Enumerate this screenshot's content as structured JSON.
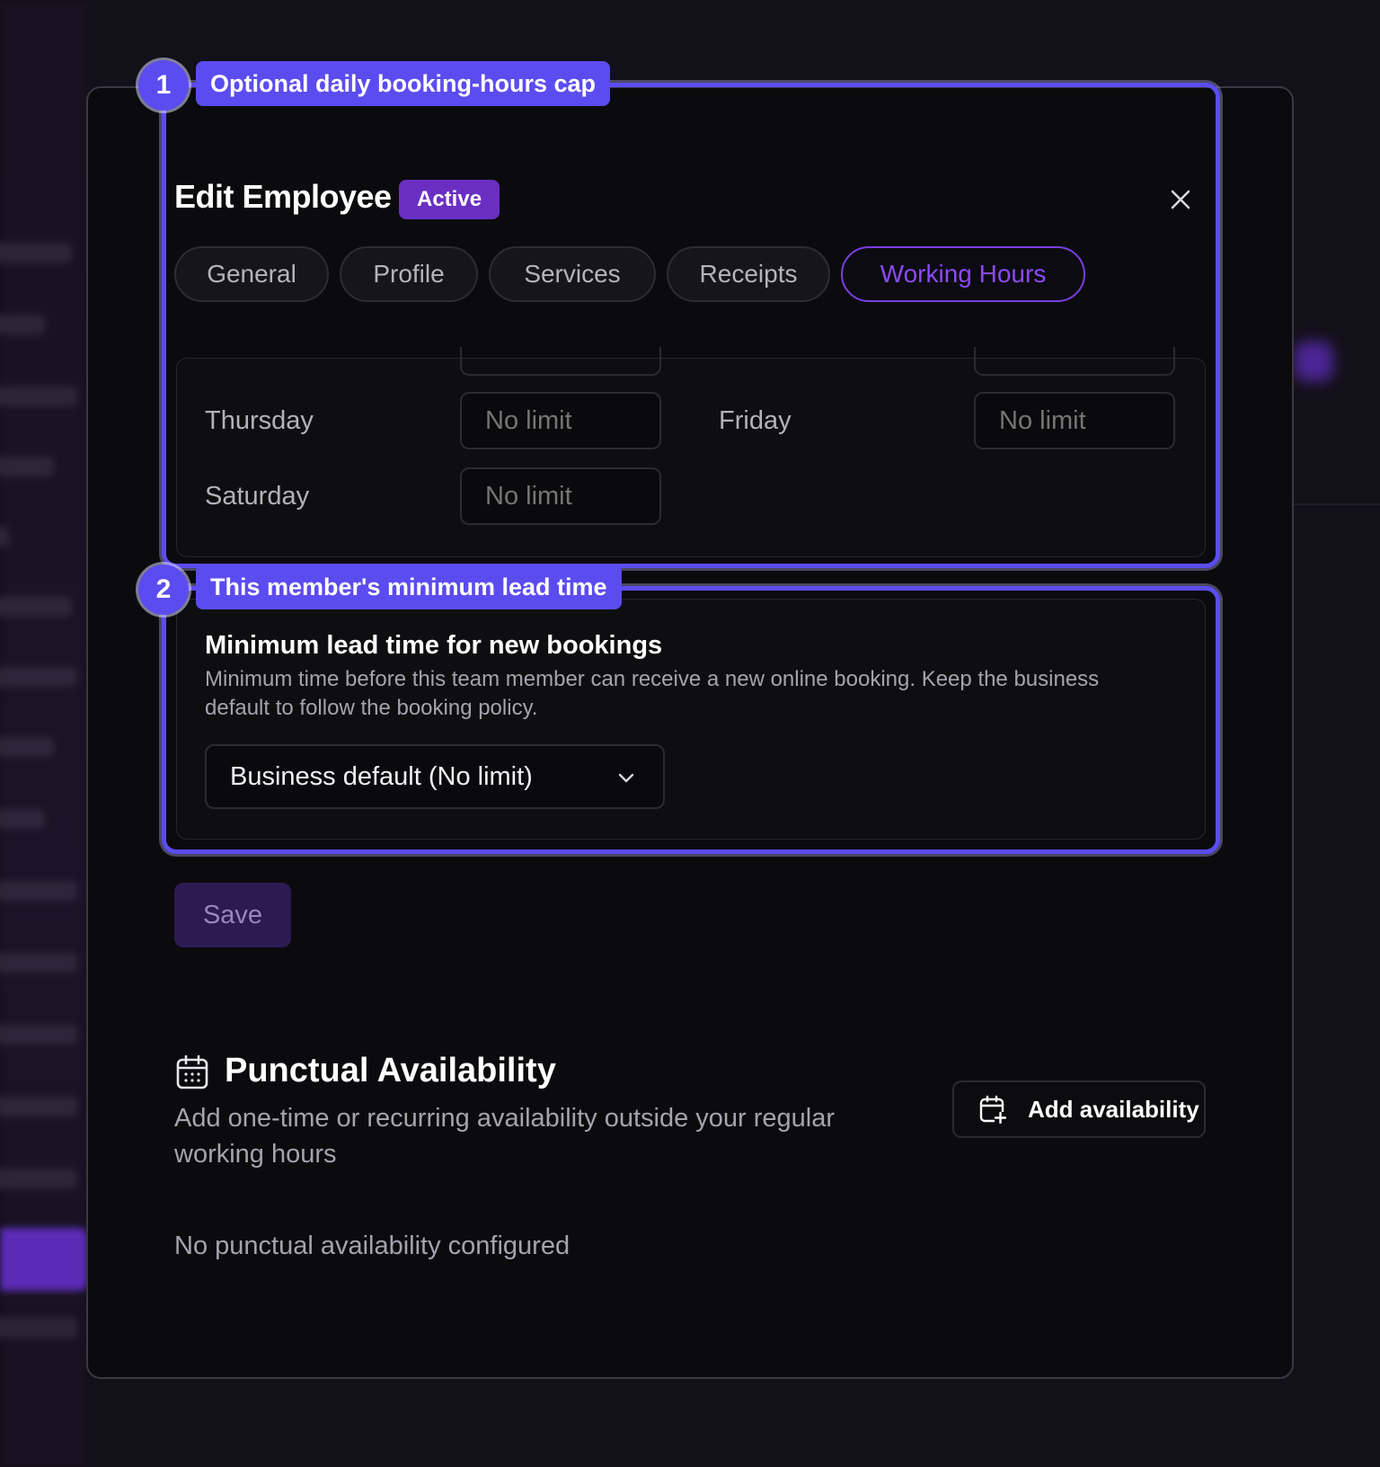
{
  "modal": {
    "title": "Edit Employee",
    "status": "Active",
    "tabs": [
      {
        "label": "General",
        "active": false
      },
      {
        "label": "Profile",
        "active": false
      },
      {
        "label": "Services",
        "active": false
      },
      {
        "label": "Receipts",
        "active": false
      },
      {
        "label": "Working Hours",
        "active": true
      }
    ]
  },
  "daily_cap": {
    "days": [
      {
        "day": "Thursday",
        "value": "No limit"
      },
      {
        "day": "Friday",
        "value": "No limit"
      },
      {
        "day": "Saturday",
        "value": "No limit"
      }
    ]
  },
  "lead_time": {
    "title": "Minimum lead time for new bookings",
    "description": "Minimum time before this team member can receive a new online booking. Keep the business default to follow the booking policy.",
    "selected": "Business default (No limit)"
  },
  "save_label": "Save",
  "punctual": {
    "title": "Punctual Availability",
    "subtitle": "Add one-time or recurring availability outside your regular working hours",
    "add_label": "Add availability",
    "empty": "No punctual availability configured"
  },
  "annotations": [
    {
      "number": "1",
      "label": "Optional daily booking-hours cap"
    },
    {
      "number": "2",
      "label": "This member's minimum lead time"
    }
  ],
  "colors": {
    "accent": "#6a2fc2",
    "highlight": "#5b4cf0",
    "background": "#0b0b0e"
  }
}
